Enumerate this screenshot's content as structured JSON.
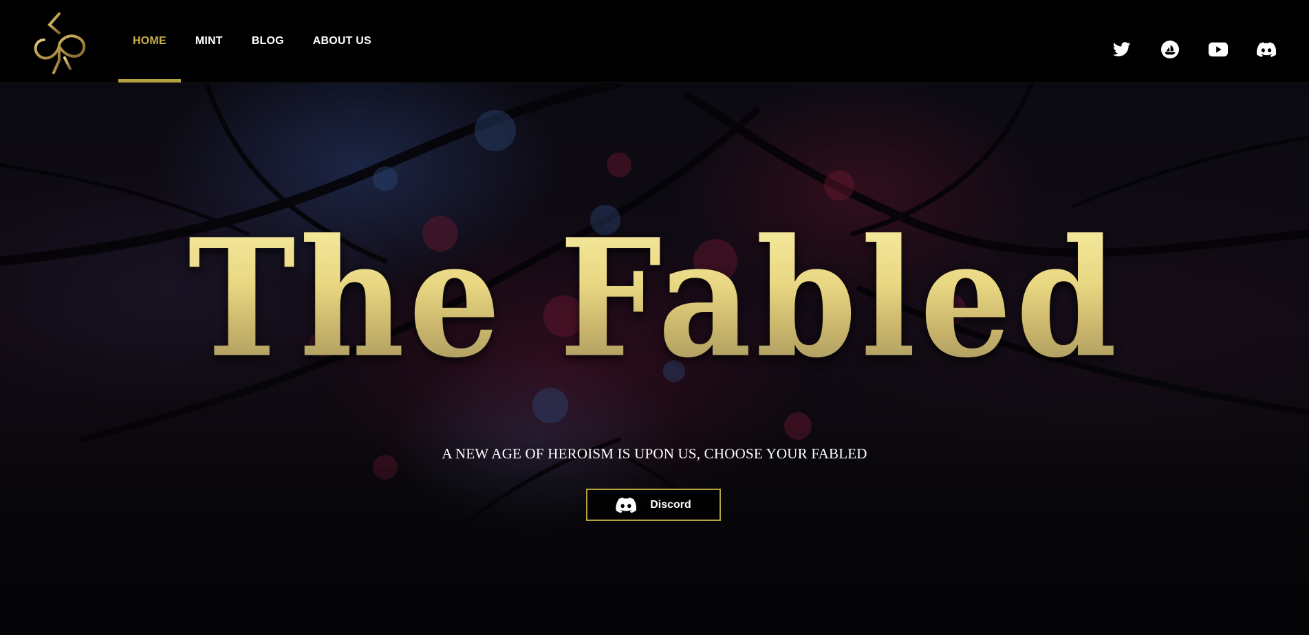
{
  "nav": {
    "items": [
      {
        "label": "HOME",
        "active": true
      },
      {
        "label": "MINT",
        "active": false
      },
      {
        "label": "BLOG",
        "active": false
      },
      {
        "label": "ABOUT US",
        "active": false
      }
    ]
  },
  "socials": [
    {
      "name": "twitter-icon"
    },
    {
      "name": "opensea-icon"
    },
    {
      "name": "youtube-icon"
    },
    {
      "name": "discord-icon"
    }
  ],
  "hero": {
    "title": "The Fabled",
    "tagline": "A NEW AGE OF HEROISM IS UPON US, CHOOSE YOUR FABLED",
    "cta_label": "Discord",
    "cta_icon": "discord-icon"
  },
  "colors": {
    "accent_gold": "#b4a33c",
    "active_nav": "#c9b14b",
    "background": "#000000",
    "text": "#ffffff"
  }
}
